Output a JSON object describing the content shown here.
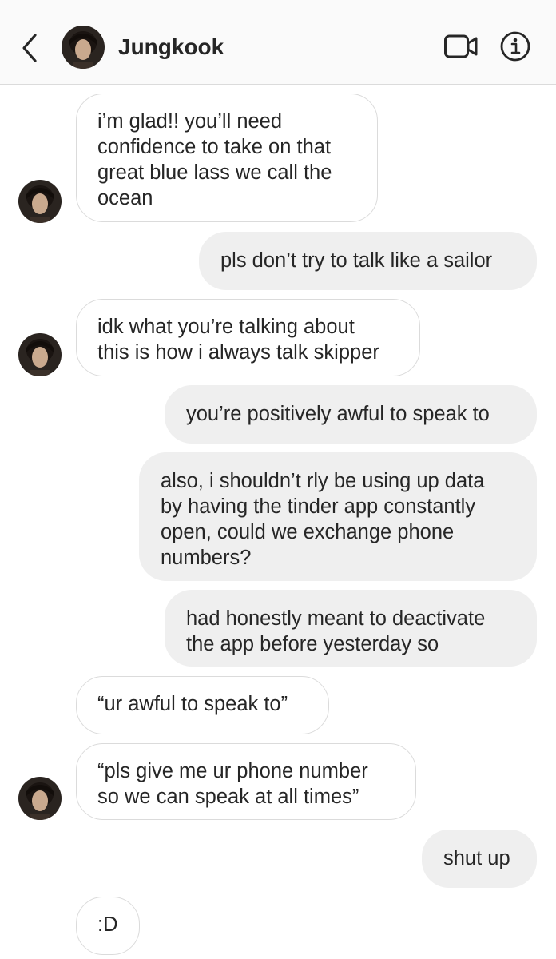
{
  "header": {
    "contact_name": "Jungkook",
    "icons": {
      "back": "chevron-left-icon",
      "video": "video-camera-icon",
      "info": "info-icon"
    }
  },
  "messages": [
    {
      "sender": "them",
      "lines": [
        "i’m glad!! you’ll need",
        "confidence to take on that",
        "great blue lass we call the",
        "ocean"
      ]
    },
    {
      "sender": "me",
      "lines": [
        "pls don’t try to talk like a sailor"
      ]
    },
    {
      "sender": "them",
      "lines": [
        "idk what you’re talking about",
        "this is how i always talk skipper"
      ]
    },
    {
      "sender": "me",
      "lines": [
        "you’re positively awful to speak to"
      ]
    },
    {
      "sender": "me",
      "lines": [
        "also, i shouldn’t rly be using up data",
        "by having the tinder app constantly",
        "open, could we exchange phone",
        "numbers?"
      ]
    },
    {
      "sender": "me",
      "lines": [
        "had honestly meant to deactivate",
        "the app before yesterday so"
      ]
    },
    {
      "sender": "them",
      "lines": [
        "“ur awful to speak to”"
      ]
    },
    {
      "sender": "them",
      "lines": [
        "“pls give me ur phone number",
        "so we can speak at all times”"
      ]
    },
    {
      "sender": "me",
      "lines": [
        "shut up"
      ]
    },
    {
      "sender": "them",
      "lines": [
        ":D"
      ]
    }
  ],
  "colors": {
    "incoming_bubble_bg": "#ffffff",
    "incoming_bubble_border": "#dbdbdb",
    "outgoing_bubble_bg": "#efefef",
    "text": "#262626",
    "header_bg": "#fafafa"
  }
}
